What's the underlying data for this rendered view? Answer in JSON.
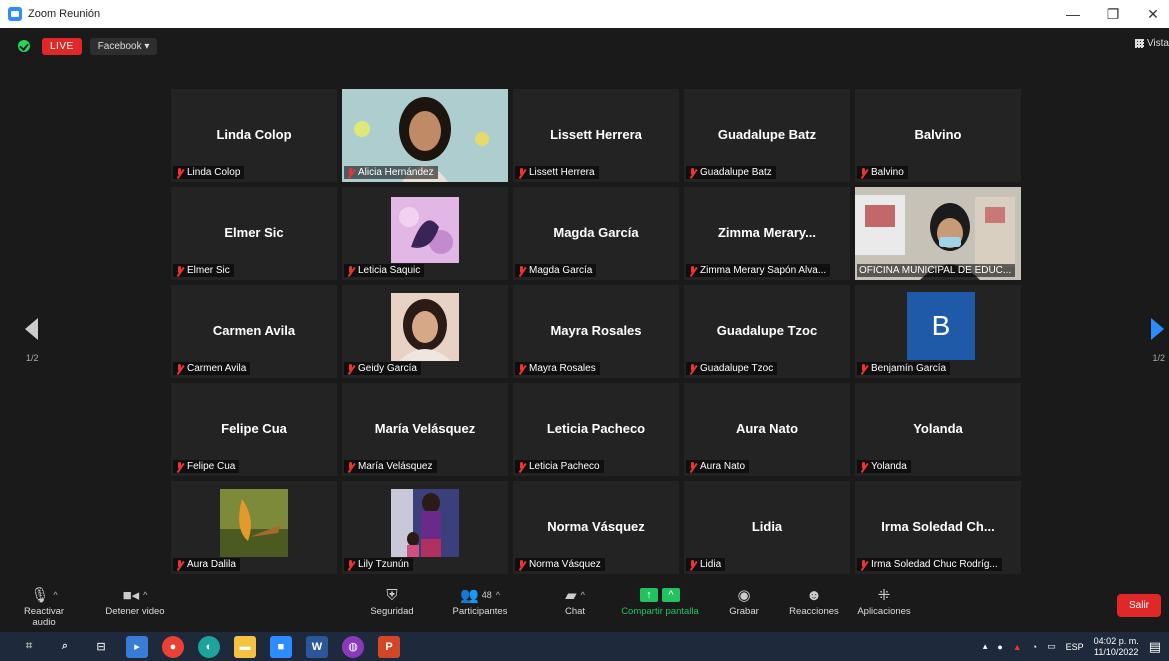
{
  "window": {
    "title": "Zoom Reunión",
    "minimize": "—",
    "restore": "❐",
    "close": "✕"
  },
  "topbar": {
    "live": "LIVE",
    "platform": "Facebook ▾",
    "view": "Vista"
  },
  "pager": {
    "left": "1/2",
    "right": "1/2"
  },
  "tiles": [
    {
      "big": "Linda Colop",
      "label": "Linda Colop"
    },
    {
      "big": "",
      "label": "Alicia Hernández"
    },
    {
      "big": "Lissett Herrera",
      "label": "Lissett Herrera"
    },
    {
      "big": "Guadalupe Batz",
      "label": "Guadalupe Batz"
    },
    {
      "big": "Balvino",
      "label": "Balvino"
    },
    {
      "big": "Elmer Sic",
      "label": "Elmer Sic"
    },
    {
      "big": "",
      "label": "Leticia Saquic"
    },
    {
      "big": "Magda García",
      "label": "Magda García"
    },
    {
      "big": "Zimma Merary...",
      "label": "Zimma Merary Sapón Alva..."
    },
    {
      "big": "",
      "label": "OFICINA MUNICIPAL DE EDUC..."
    },
    {
      "big": "Carmen Avila",
      "label": "Carmen Avila"
    },
    {
      "big": "",
      "label": "Geidy García"
    },
    {
      "big": "Mayra Rosales",
      "label": "Mayra Rosales"
    },
    {
      "big": "Guadalupe Tzoc",
      "label": "Guadalupe Tzoc"
    },
    {
      "big": "B",
      "label": "Benjamín García"
    },
    {
      "big": "Felipe Cua",
      "label": "Felipe Cua"
    },
    {
      "big": "María Velásquez",
      "label": "María Velásquez"
    },
    {
      "big": "Leticia Pacheco",
      "label": "Leticia Pacheco"
    },
    {
      "big": "Aura Nato",
      "label": "Aura Nato"
    },
    {
      "big": "Yolanda",
      "label": "Yolanda"
    },
    {
      "big": "",
      "label": "Aura Dalila"
    },
    {
      "big": "",
      "label": "Lily Tzunún"
    },
    {
      "big": "Norma  Vásquez",
      "label": "Norma  Vásquez"
    },
    {
      "big": "Lidia",
      "label": "Lidia"
    },
    {
      "big": "Irma Soledad Ch...",
      "label": "Irma Soledad Chuc Rodríg..."
    }
  ],
  "toolbar": {
    "unmute": "Reactivar audio",
    "stop_video": "Detener video",
    "security": "Seguridad",
    "participants": "Participantes",
    "participants_count": "48",
    "chat": "Chat",
    "share": "Compartir pantalla",
    "record": "Grabar",
    "reactions": "Reacciones",
    "apps": "Aplicaciones",
    "leave": "Salir"
  },
  "taskbar": {
    "lang": "ESP",
    "time": "04:02 p. m.",
    "date": "11/10/2022"
  },
  "colors": {
    "accent": "#2d8cff",
    "live": "#e02828",
    "share": "#22c35f",
    "active_border": "#c9e04a"
  }
}
